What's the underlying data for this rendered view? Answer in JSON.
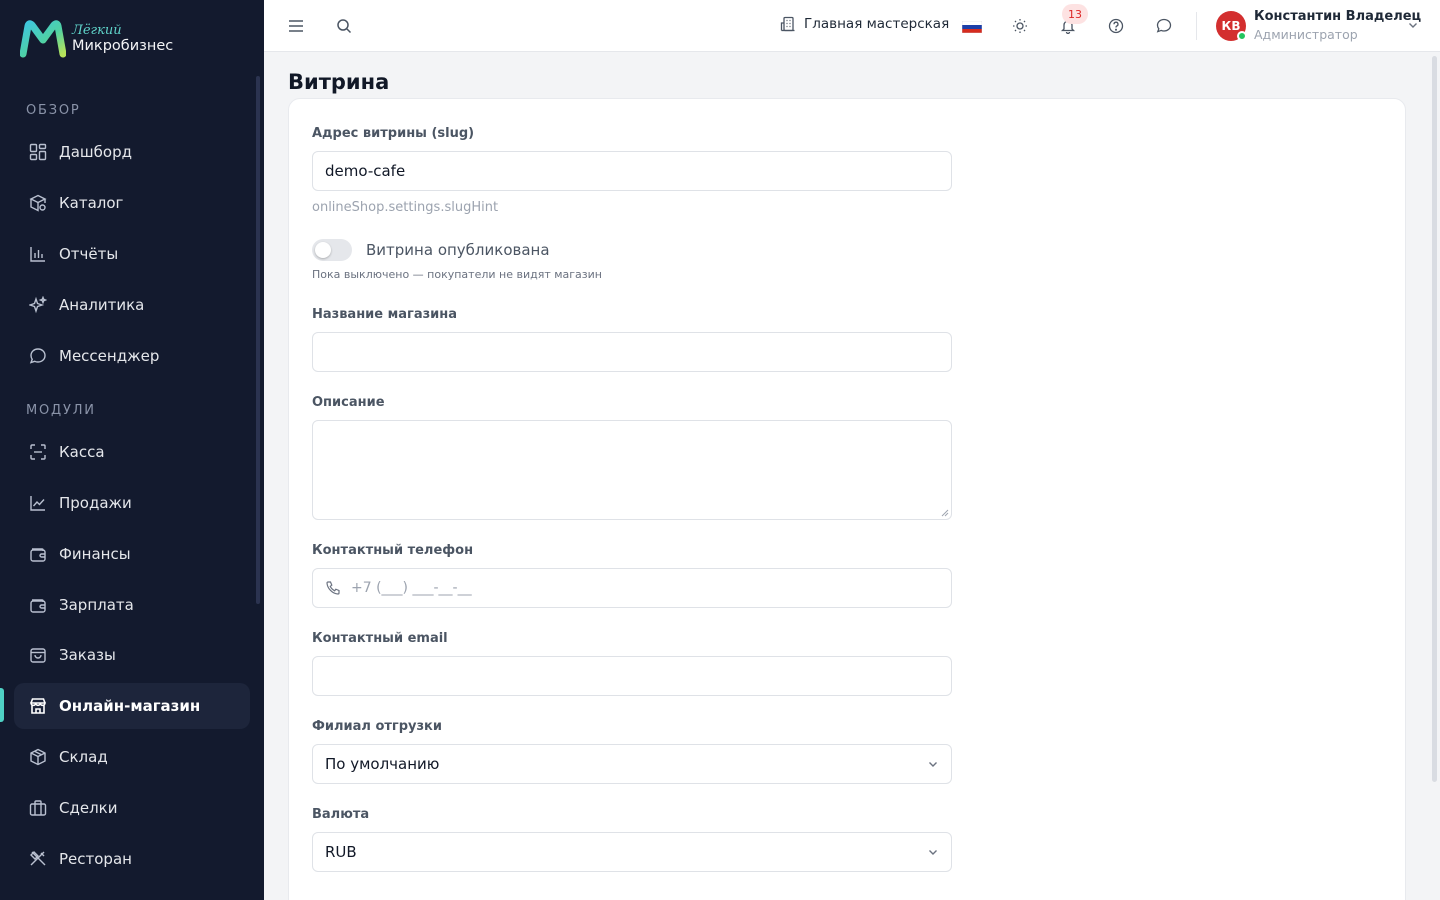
{
  "app": {
    "logo_top": "Лёгкий",
    "logo_bottom": "Микробизнес"
  },
  "sidebar": {
    "sections": [
      {
        "title": "Обзор"
      },
      {
        "title": "Модули"
      }
    ],
    "items": [
      {
        "label": "Дашборд",
        "icon": "dashboard-icon"
      },
      {
        "label": "Каталог",
        "icon": "catalog-icon"
      },
      {
        "label": "Отчёты",
        "icon": "reports-icon"
      },
      {
        "label": "Аналитика",
        "icon": "sparkle-icon"
      },
      {
        "label": "Мессенджер",
        "icon": "chat-icon"
      },
      {
        "label": "Касса",
        "icon": "scan-icon"
      },
      {
        "label": "Продажи",
        "icon": "chart-line-icon"
      },
      {
        "label": "Финансы",
        "icon": "wallet-icon"
      },
      {
        "label": "Зарплата",
        "icon": "wallet-icon"
      },
      {
        "label": "Заказы",
        "icon": "bag-icon"
      },
      {
        "label": "Онлайн-магазин",
        "icon": "store-icon",
        "active": true
      },
      {
        "label": "Склад",
        "icon": "box-icon"
      },
      {
        "label": "Сделки",
        "icon": "briefcase-icon"
      },
      {
        "label": "Ресторан",
        "icon": "cutlery-icon"
      }
    ]
  },
  "topbar": {
    "workshop": "Главная мастерская",
    "notifications_count": "13",
    "user_initials": "КВ",
    "user_name": "Константин Владелец",
    "user_role": "Администратор"
  },
  "page": {
    "title": "Витрина"
  },
  "form": {
    "slug_label": "Адрес витрины (slug)",
    "slug_value": "demo-cafe",
    "slug_hint": "onlineShop.settings.slugHint",
    "published_label": "Витрина опубликована",
    "published": false,
    "published_hint": "Пока выключено — покупатели не видят магазин",
    "name_label": "Название магазина",
    "name_value": "",
    "description_label": "Описание",
    "description_value": "",
    "phone_label": "Контактный телефон",
    "phone_placeholder": "+7 (___) ___-__-__",
    "email_label": "Контактный email",
    "email_value": "",
    "branch_label": "Филиал отгрузки",
    "branch_value": "По умолчанию",
    "currency_label": "Валюта",
    "currency_value": "RUB"
  },
  "colors": {
    "sidebar_bg": "#131a2e",
    "accent": "#4fd1c5",
    "badge_text": "#dc2626"
  }
}
